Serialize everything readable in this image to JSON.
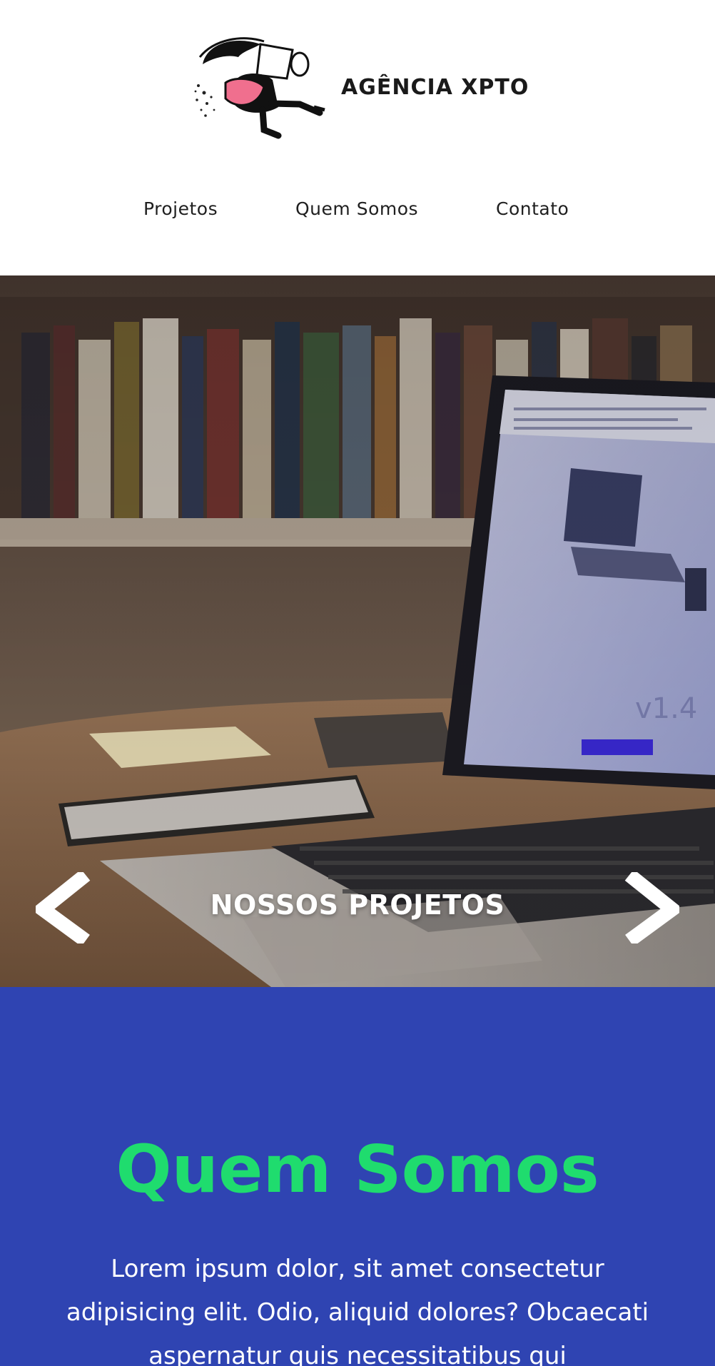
{
  "header": {
    "brand_name": "AGÊNCIA XPTO",
    "logo_icon": "running-character-logo"
  },
  "nav": {
    "items": [
      {
        "label": "Projetos"
      },
      {
        "label": "Quem Somos"
      },
      {
        "label": "Contato"
      }
    ]
  },
  "hero": {
    "title": "NOSSOS PROJETOS",
    "prev_icon": "chevron-left-icon",
    "next_icon": "chevron-right-icon"
  },
  "about": {
    "title": "Quem Somos",
    "text": "Lorem ipsum dolor, sit amet consectetur adipisicing elit. Odio, aliquid dolores? Obcaecati aspernatur quis necessitatibus qui"
  },
  "colors": {
    "about_bg": "#2f44b2",
    "about_title": "#1fdc6e",
    "text_dark": "#1a1a1a"
  }
}
